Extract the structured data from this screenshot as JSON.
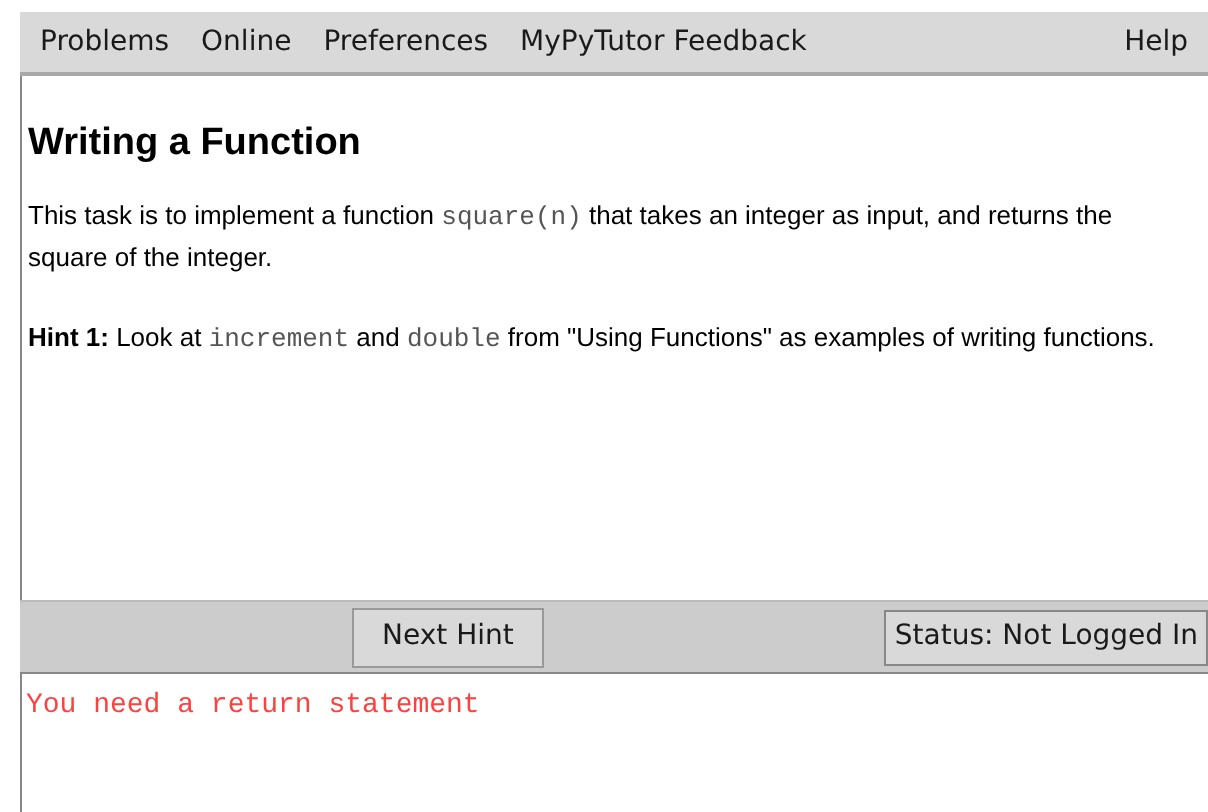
{
  "menu": {
    "left": [
      "Problems",
      "Online",
      "Preferences",
      "MyPyTutor Feedback"
    ],
    "right": [
      "Help"
    ]
  },
  "problem": {
    "title": "Writing a Function",
    "paragraphs": [
      [
        {
          "kind": "text",
          "text": "This task is to implement a function "
        },
        {
          "kind": "code",
          "text": "square(n)"
        },
        {
          "kind": "text",
          "text": " that takes an integer as input, and returns the square of the integer."
        }
      ],
      [
        {
          "kind": "bold",
          "text": "Hint 1:"
        },
        {
          "kind": "text",
          "text": " Look at "
        },
        {
          "kind": "code",
          "text": "increment"
        },
        {
          "kind": "text",
          "text": " and "
        },
        {
          "kind": "code",
          "text": "double"
        },
        {
          "kind": "text",
          "text": " from \"Using Functions\" as examples of writing functions."
        }
      ]
    ]
  },
  "toolbar": {
    "button": "Next Hint",
    "status": "Status: Not Logged In"
  },
  "output": {
    "message": "You need a return statement"
  }
}
